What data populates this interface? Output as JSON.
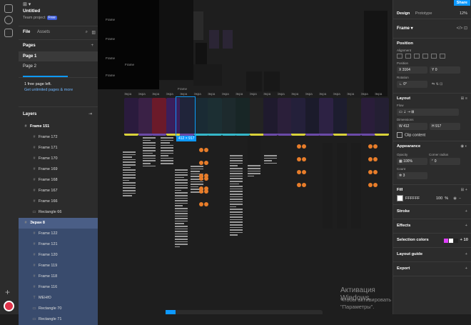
{
  "file": {
    "title": "Untitled",
    "team": "Team project",
    "plan_badge": "Free",
    "tabs": [
      "File",
      "Assets"
    ]
  },
  "pages": {
    "heading": "Pages",
    "items": [
      "Page 1",
      "Page 2"
    ],
    "selected_index": 0,
    "notice_line1": "1 free page left.",
    "notice_link": "Get unlimited pages & more"
  },
  "layers": {
    "heading": "Layers",
    "items": [
      {
        "name": "Frame 151",
        "depth": 1,
        "icon": "#"
      },
      {
        "name": "Frame 172",
        "depth": 2,
        "icon": "#"
      },
      {
        "name": "Frame 171",
        "depth": 2,
        "icon": "#"
      },
      {
        "name": "Frame 170",
        "depth": 2,
        "icon": "#"
      },
      {
        "name": "Frame 169",
        "depth": 2,
        "icon": "#"
      },
      {
        "name": "Frame 168",
        "depth": 2,
        "icon": "#"
      },
      {
        "name": "Frame 167",
        "depth": 2,
        "icon": "#"
      },
      {
        "name": "Frame 166",
        "depth": 2,
        "icon": "#"
      },
      {
        "name": "Rectangle 66",
        "depth": 2,
        "icon": "▭"
      },
      {
        "name": "Экран 8",
        "depth": 1,
        "icon": "#",
        "highlight": "selected"
      },
      {
        "name": "Frame 122",
        "depth": 2,
        "icon": "#",
        "highlight": "child"
      },
      {
        "name": "Frame 121",
        "depth": 2,
        "icon": "#",
        "highlight": "child"
      },
      {
        "name": "Frame 120",
        "depth": 2,
        "icon": "#",
        "highlight": "child"
      },
      {
        "name": "Frame 119",
        "depth": 2,
        "icon": "#",
        "highlight": "child"
      },
      {
        "name": "Frame 118",
        "depth": 2,
        "icon": "#",
        "highlight": "child"
      },
      {
        "name": "Frame 116",
        "depth": 2,
        "icon": "#",
        "highlight": "child"
      },
      {
        "name": "МЕНЮ",
        "depth": 2,
        "icon": "T",
        "highlight": "child"
      },
      {
        "name": "Rectangle 70",
        "depth": 2,
        "icon": "▭",
        "highlight": "child"
      },
      {
        "name": "Rectangle 71",
        "depth": 2,
        "icon": "▭",
        "highlight": "child"
      }
    ]
  },
  "canvas": {
    "selection_size": "412 × 917",
    "watermark_title": "Активация Windows",
    "watermark_body": "Чтобы активировать Windows, перейдите в раздел \"Параметры\".",
    "frame_labels": [
      "Frame",
      "Frame",
      "Frame",
      "Frame",
      "Frame",
      "Frame",
      "Экра",
      "Экра",
      "Экра",
      "Экра",
      "Экра",
      "Экра",
      "Экра",
      "Экра",
      "Экра",
      "Экра",
      "Экра",
      "Экра",
      "Экра",
      "Экра",
      "Экра"
    ],
    "screen_colors": [
      "#2a1b3d",
      "#3a2146",
      "#6b1a2a",
      "#3a1f5c",
      "#20243a",
      "#1a2b34",
      "#1c2f33",
      "#1d2a2d",
      "#182626",
      "#232323",
      "#1f1a2e",
      "#2b1f3a",
      "#24203a",
      "#1b1b2b",
      "#2d2244",
      "#1d1d2f",
      "#222",
      "#2a1d3a",
      "#241f33"
    ],
    "accent_colors": {
      "selection": "#0d99ff",
      "orange": "#e87d2a",
      "yellow": "#d9d23a",
      "teal": "#35b8c9"
    }
  },
  "right_panel": {
    "share_label": "Share",
    "tabs": [
      "Design",
      "Prototype"
    ],
    "zoom": "12%",
    "frame_label": "Frame",
    "position": {
      "heading": "Position",
      "alignment_label": "Alignment",
      "position_label": "Position",
      "x": "3164",
      "y": "0",
      "rotation_label": "Rotation",
      "rotation": "0°"
    },
    "layout": {
      "heading": "Layout",
      "flow_label": "Flow",
      "dimensions_label": "Dimensions",
      "w": "412",
      "h": "917",
      "clip_content": "Clip content"
    },
    "appearance": {
      "heading": "Appearance",
      "opacity_label": "Opacity",
      "opacity": "100%",
      "corner_radius_label": "Corner radius",
      "corner_radius": "0",
      "count_label": "Count",
      "count": "3"
    },
    "fill": {
      "heading": "Fill",
      "hex": "FFFFFF",
      "opacity": "100",
      "unit": "%"
    },
    "stroke_heading": "Stroke",
    "effects_heading": "Effects",
    "selection_colors_heading": "Selection colors",
    "selection_colors_extra": "+ 10",
    "layout_guide_heading": "Layout guide",
    "export_heading": "Export"
  }
}
